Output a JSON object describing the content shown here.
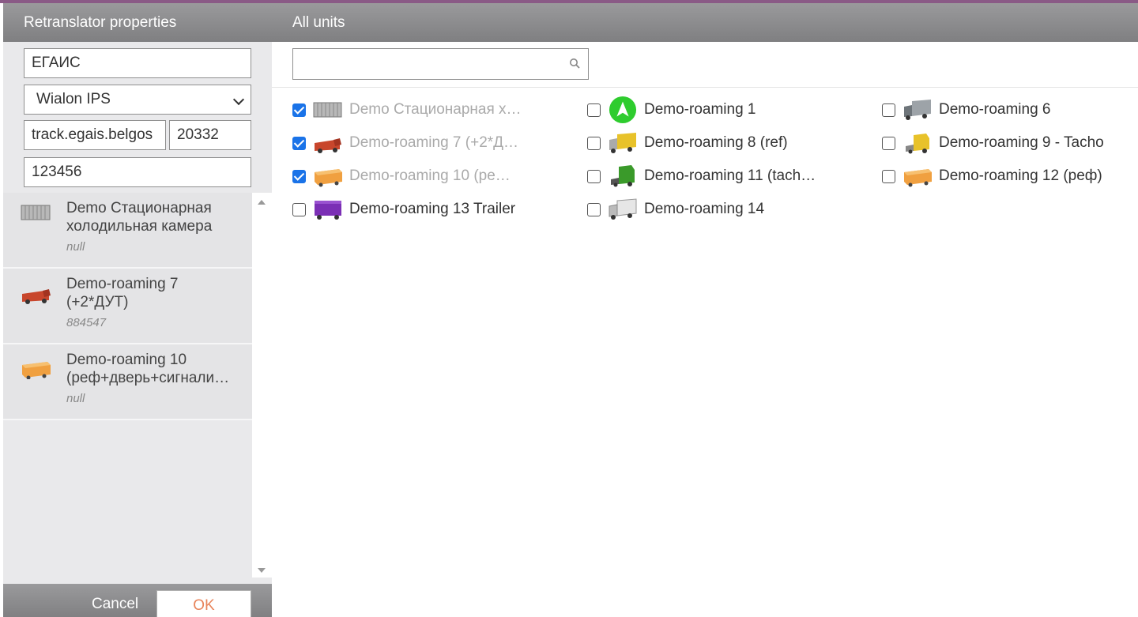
{
  "left_panel": {
    "title": "Retranslator properties",
    "name_value": "ЕГАИС",
    "protocol_value": "Wialon IPS",
    "server_value": "track.egais.belgos",
    "port_value": "20332",
    "password_value": "123456",
    "selected_units": [
      {
        "name": "Demo Стационарная холодильная камера",
        "sub": "null",
        "icon": "container-gray-icon"
      },
      {
        "name": "Demo-roaming 7 (+2*ДУТ)",
        "sub": "884547",
        "icon": "truck-red-icon"
      },
      {
        "name": "Demo-roaming 10 (реф+дверь+сигнали…",
        "sub": "null",
        "icon": "trailer-orange-icon"
      }
    ],
    "cancel_label": "Cancel",
    "ok_label": "OK"
  },
  "right_panel": {
    "title": "All units",
    "search_value": "",
    "units": [
      {
        "label": "Demo Стационарная х…",
        "checked": true,
        "icon": "container-gray-icon"
      },
      {
        "label": "Demo-roaming 1",
        "checked": false,
        "icon": "green-arrow-icon"
      },
      {
        "label": "Demo-roaming 6",
        "checked": false,
        "icon": "truck-gray-icon"
      },
      {
        "label": "Demo-roaming 7 (+2*Д…",
        "checked": true,
        "icon": "truck-red-icon"
      },
      {
        "label": "Demo-roaming 8 (ref)",
        "checked": false,
        "icon": "truck-yellow-icon"
      },
      {
        "label": "Demo-roaming 9 - Tacho",
        "checked": false,
        "icon": "tractor-yellow-icon"
      },
      {
        "label": "Demo-roaming 10 (ре…",
        "checked": true,
        "icon": "trailer-orange-icon"
      },
      {
        "label": "Demo-roaming 11 (tach…",
        "checked": false,
        "icon": "tractor-green-icon"
      },
      {
        "label": "Demo-roaming 12 (реф)",
        "checked": false,
        "icon": "trailer-orange-icon"
      },
      {
        "label": "Demo-roaming 13 Trailer",
        "checked": false,
        "icon": "trailer-purple-icon"
      },
      {
        "label": "Demo-roaming 14",
        "checked": false,
        "icon": "truck-white-icon"
      }
    ]
  },
  "colors": {
    "header_gray": "#8c8c8e",
    "accent_purple": "#8a5a86",
    "ok_text": "#e8845b",
    "checkbox_blue": "#1a73e8"
  }
}
